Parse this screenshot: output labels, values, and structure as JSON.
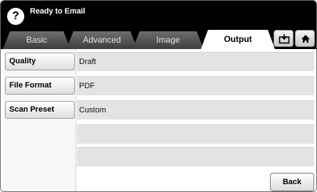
{
  "header": {
    "help_icon": "?",
    "title": "Ready to Email"
  },
  "tabs": [
    {
      "label": "Basic",
      "active": false
    },
    {
      "label": "Advanced",
      "active": false
    },
    {
      "label": "Image",
      "active": false
    },
    {
      "label": "Output",
      "active": true
    }
  ],
  "toolbar_icons": [
    "tray-icon",
    "home-icon"
  ],
  "settings": [
    {
      "label": "Quality",
      "value": "Draft"
    },
    {
      "label": "File Format",
      "value": "PDF"
    },
    {
      "label": "Scan Preset",
      "value": "Custom"
    }
  ],
  "footer": {
    "back_label": "Back"
  }
}
